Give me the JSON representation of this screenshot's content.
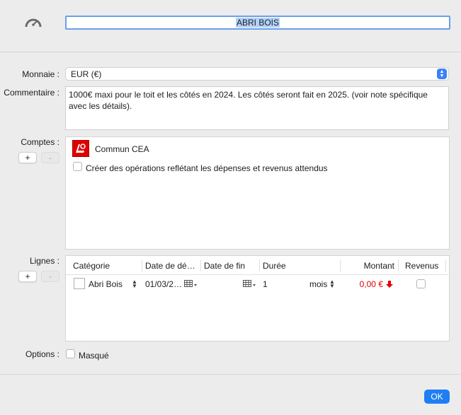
{
  "header": {
    "name_value": "ABRI BOIS"
  },
  "form": {
    "currency_label": "Monnaie :",
    "currency_value": "EUR (€)",
    "comment_label": "Commentaire :",
    "comment_value": "1000€ maxi pour le toit et les côtés en 2024. Les côtés seront fait en 2025. (voir note spécifique avec les détails).",
    "accounts_label": "Comptes :",
    "lines_label": "Lignes :",
    "options_label": "Options :"
  },
  "accounts": {
    "add_label": "+",
    "remove_label": "-",
    "items": [
      {
        "name": "Commun CEA"
      }
    ],
    "create_ops_label": "Créer des opérations reflétant les dépenses et revenus attendus"
  },
  "lines": {
    "add_label": "+",
    "remove_label": "-",
    "columns": [
      "Catégorie",
      "Date de dé…",
      "Date de fin",
      "Durée",
      "Montant",
      "Revenus"
    ],
    "rows": [
      {
        "category": "Abri Bois",
        "start_date": "01/03/2…",
        "end_date": "",
        "duration": "1",
        "duration_unit": "mois",
        "amount": "0,00 €"
      }
    ]
  },
  "options": {
    "hidden_label": "Masqué"
  },
  "footer": {
    "ok_label": "OK"
  },
  "colors": {
    "accent": "#1f7ef3",
    "negative": "#e00000",
    "selection": "#b3d2fb"
  }
}
